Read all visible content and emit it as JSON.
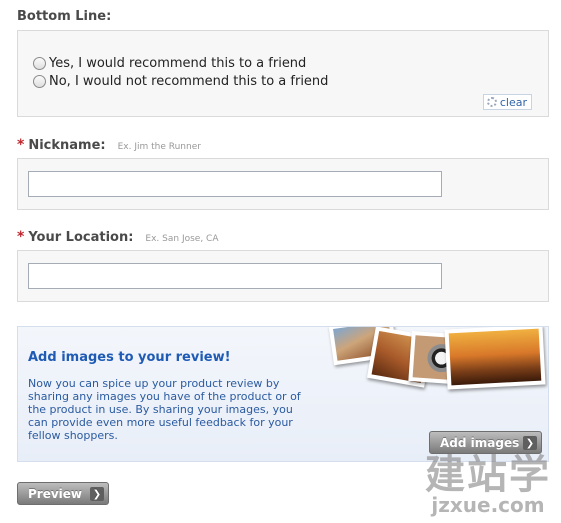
{
  "bottom_line": {
    "label": "Bottom Line:",
    "option_yes": "Yes, I would recommend this to a friend",
    "option_no": "No, I would not recommend this to a friend",
    "clear_label": "clear"
  },
  "nickname": {
    "label": "Nickname:",
    "hint": "Ex. Jim the Runner",
    "value": ""
  },
  "location": {
    "label": "Your Location:",
    "hint": "Ex. San Jose, CA",
    "value": ""
  },
  "images_promo": {
    "title": "Add images to your review!",
    "text": "Now you can spice up your product review by sharing any images you have of the product or of the product in use. By sharing your images, you can provide even more useful feedback for your fellow shoppers.",
    "button_label": "Add images"
  },
  "preview_button": {
    "label": "Preview"
  },
  "watermark": {
    "brand": "建站学",
    "url": "jzxue.com"
  },
  "colors": {
    "required_star": "#c0262d",
    "promo_title": "#1f5bb5",
    "link": "#3064a8"
  }
}
